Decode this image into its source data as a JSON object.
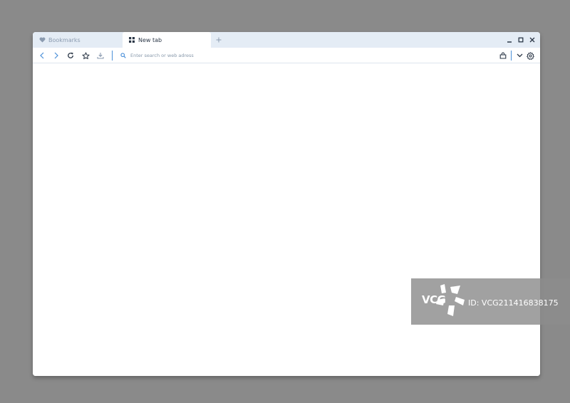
{
  "tabs": [
    {
      "label": "Bookmarks",
      "icon": "heart-icon",
      "active": false
    },
    {
      "label": "New tab",
      "icon": "grid-icon",
      "active": true
    }
  ],
  "new_tab_icon": "plus-icon",
  "window_controls": [
    "minimize-icon",
    "maximize-icon",
    "close-icon"
  ],
  "toolbar": {
    "buttons": [
      "back-icon",
      "forward-icon",
      "reload-icon",
      "star-icon",
      "download-icon"
    ],
    "right_buttons": [
      "share-icon",
      "chevron-down-icon",
      "gear-icon"
    ]
  },
  "address_bar": {
    "icon": "search-icon",
    "placeholder": "Enter search or web adress",
    "value": ""
  },
  "watermark": {
    "logo": "VCG",
    "id_text": "ID: VCG211416838175"
  },
  "colors": {
    "background": "#8a8a8a",
    "tab_bar": "#e4ecf5",
    "accent": "#4a90d9",
    "icon": "#2b3747",
    "muted_text": "#8b9bb0"
  }
}
